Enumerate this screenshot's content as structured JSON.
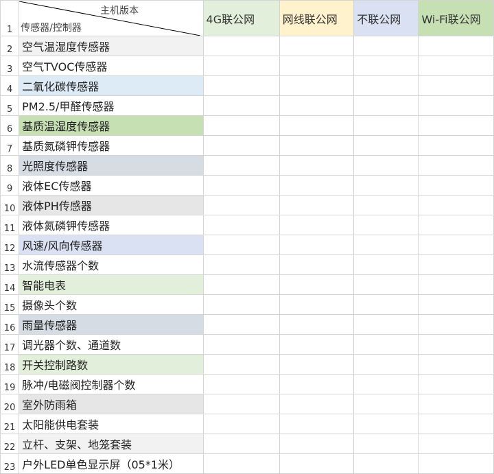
{
  "header": {
    "diagonal_top": "主机版本",
    "diagonal_bottom": "传感器/控制器",
    "row_number": "1",
    "columns": [
      {
        "label": "4G联公网",
        "bg": "#e2efda"
      },
      {
        "label": "网线联公网",
        "bg": "#fff2cc"
      },
      {
        "label": "不联公网",
        "bg": "#d9e1f2"
      },
      {
        "label": "Wi-Fi联公网",
        "bg": "#c6e0b4"
      }
    ]
  },
  "rows": [
    {
      "num": "2",
      "label": "空气温湿度传感器",
      "bg": "#f2f2f2"
    },
    {
      "num": "3",
      "label": "空气TVOC传感器",
      "bg": "#ffffff"
    },
    {
      "num": "4",
      "label": "二氧化碳传感器",
      "bg": "#ddebf7"
    },
    {
      "num": "5",
      "label": "PM2.5/甲醛传感器",
      "bg": "#ffffff"
    },
    {
      "num": "6",
      "label": "基质温湿度传感器",
      "bg": "#c6e0b4"
    },
    {
      "num": "7",
      "label": "基质氮磷钾传感器",
      "bg": "#ffffff"
    },
    {
      "num": "8",
      "label": "光照度传感器",
      "bg": "#d6dce4"
    },
    {
      "num": "9",
      "label": "液体EC传感器",
      "bg": "#ffffff"
    },
    {
      "num": "10",
      "label": "液体PH传感器",
      "bg": "#e7e6e6"
    },
    {
      "num": "11",
      "label": "液体氮磷钾传感器",
      "bg": "#ffffff"
    },
    {
      "num": "12",
      "label": "风速/风向传感器",
      "bg": "#d9e1f2"
    },
    {
      "num": "13",
      "label": "水流传感器个数",
      "bg": "#ffffff"
    },
    {
      "num": "14",
      "label": "智能电表",
      "bg": "#e2efda"
    },
    {
      "num": "15",
      "label": "摄像头个数",
      "bg": "#ffffff"
    },
    {
      "num": "16",
      "label": "雨量传感器",
      "bg": "#d6dce4"
    },
    {
      "num": "17",
      "label": "调光器个数、通道数",
      "bg": "#ffffff"
    },
    {
      "num": "18",
      "label": "开关控制路数",
      "bg": "#e2efda"
    },
    {
      "num": "19",
      "label": "脉冲/电磁阀控制器个数",
      "bg": "#ffffff"
    },
    {
      "num": "20",
      "label": "室外防雨箱",
      "bg": "#e7e6e6"
    },
    {
      "num": "21",
      "label": "太阳能供电套装",
      "bg": "#ffffff"
    },
    {
      "num": "22",
      "label": "立杆、支架、地笼套装",
      "bg": "#f2f2f2"
    },
    {
      "num": "23",
      "label": "户外LED单色显示屏（05*1米）",
      "bg": "#ffffff"
    }
  ]
}
